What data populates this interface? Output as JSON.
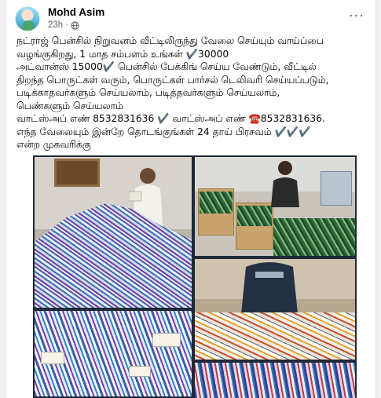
{
  "post": {
    "author": "Mohd Asim",
    "time": "23h",
    "audience_icon": "globe-icon",
    "more_icon": "more-options-icon",
    "text_lines": [
      "நட்ராஜ் பென்சில் நிறுவனம் வீட்டிலிருந்து வேலை செய்யும் வாய்ப்பை வழங்குகிறது, 1 மாத சம்பளம் உங்கள் ✔️30000",
      "அட்வான்ஸ் 15000✔️ பென்சில் பேக்கிங் செய்ய வேண்டும், வீட்டில் திறந்த பொருட்கள் வரும், பொருட்கள் பார்சல் டெலிவரி செய்யப்படும், படிக்காதவர்களும் செய்யலாம், படித்தவர்களும் செய்யலாம், பெண்களும் செய்யலாம்",
      "வாட்ஸ்அப் எண் 8532831636 ✔️ வாட்ஸ்அப் எண் ☎️8532831636. எந்த வேலையும் இன்றே தொடங்குங்கள் 24 தாய் பிரசவம் ✔️✔️✔️ என்ற முகவரிக்கு"
    ]
  },
  "photos": [
    {
      "name": "pen-pile-photo"
    },
    {
      "name": "packing-boxes-photo"
    },
    {
      "name": "pen-closeup-photo"
    },
    {
      "name": "assorted-pens-photo"
    },
    {
      "name": "pen-rows-photo"
    }
  ],
  "colors": {
    "author": "#050505",
    "meta": "#65676b",
    "background": "#f0f2f5",
    "card": "#ffffff",
    "grid_bg": "#1f2937"
  }
}
